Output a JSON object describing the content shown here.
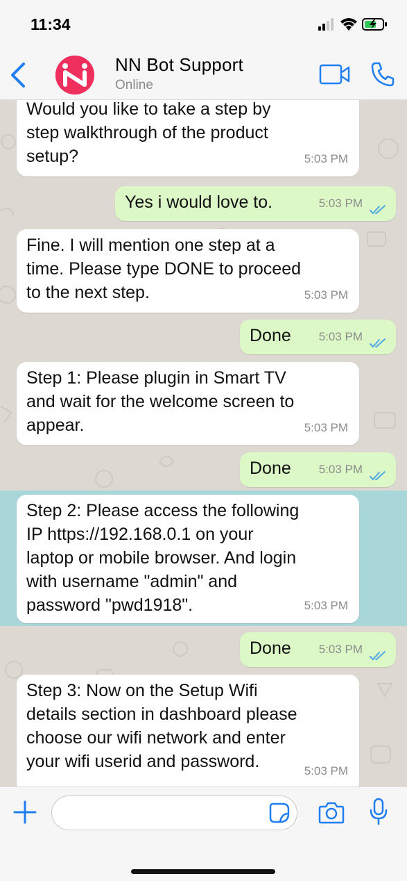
{
  "status_bar": {
    "time": "11:34"
  },
  "header": {
    "back_icon": "chevron-left-icon",
    "contact_name": "NN Bot Support",
    "contact_status": "Online",
    "avatar_color": "#ef2f5e",
    "video_icon": "video-camera-icon",
    "call_icon": "phone-icon"
  },
  "messages": [
    {
      "direction": "in",
      "lines": "Would you like to take a step by\nstep walkthrough of the product\nsetup?",
      "time": "5:03 PM"
    },
    {
      "direction": "out",
      "lines": "Yes i would love to.",
      "time": "5:03 PM",
      "read": true
    },
    {
      "direction": "in",
      "lines": "Fine. I will mention one step at a\ntime. Please type DONE to proceed\nto the next step.",
      "time": "5:03 PM"
    },
    {
      "direction": "out",
      "lines": "Done",
      "time": "5:03 PM",
      "read": true
    },
    {
      "direction": "in",
      "lines": "Step 1: Please plugin in Smart TV\nand wait for the welcome screen to\nappear.",
      "time": "5:03 PM"
    },
    {
      "direction": "out",
      "lines": "Done",
      "time": "5:03 PM",
      "read": true
    },
    {
      "direction": "in",
      "lines": "Step 2: Please access the following\nIP https://192.168.0.1 on your\nlaptop or mobile browser. And login\nwith username \"admin\" and\npassword \"pwd1918\".",
      "time": "5:03 PM",
      "highlighted": true
    },
    {
      "direction": "out",
      "lines": "Done",
      "time": "5:03 PM",
      "read": true
    },
    {
      "direction": "in",
      "lines": "Step 3: Now on the Setup Wifi\ndetails section in dashboard please\nchoose our wifi network and enter\nyour wifi userid and password.",
      "time": "5:03 PM"
    }
  ],
  "composer": {
    "value": "",
    "placeholder": "",
    "plus_icon": "plus-icon",
    "sticker_icon": "sticker-icon",
    "camera_icon": "camera-icon",
    "mic_icon": "microphone-icon"
  },
  "colors": {
    "accent": "#1f7ef2",
    "outgoing_bubble": "#dcf8c6",
    "incoming_bubble": "#ffffff",
    "chat_background": "#ddd8d2",
    "highlight": "#a8d6d9",
    "read_ticks": "#4fa9e8"
  }
}
